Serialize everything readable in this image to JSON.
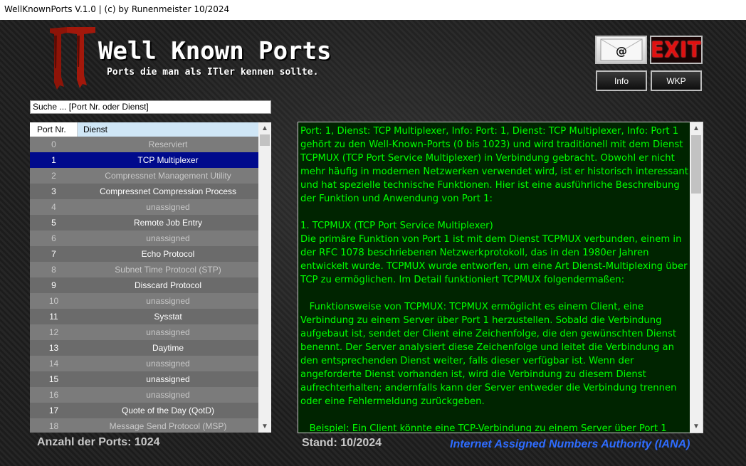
{
  "window": {
    "title": "WellKnownPorts V.1.0 | (c) by Runenmeister 10/2024"
  },
  "logo": {
    "mark": "IT",
    "title": "Well Known Ports",
    "subtitle": "Ports die man als ITler kennen sollte."
  },
  "toolbar": {
    "mail_label": "@",
    "exit_label": "EXIT",
    "info_label": "Info",
    "wkp_label": "WKP"
  },
  "search": {
    "value": "Suche ... [Port Nr. oder Dienst]"
  },
  "list": {
    "headers": {
      "port": "Port Nr.",
      "service": "Dienst"
    },
    "rows": [
      {
        "port": "0",
        "name": "Reserviert"
      },
      {
        "port": "1",
        "name": "TCP Multiplexer"
      },
      {
        "port": "2",
        "name": "Compressnet Management Utility"
      },
      {
        "port": "3",
        "name": "Compressnet Compression Process"
      },
      {
        "port": "4",
        "name": "unassigned"
      },
      {
        "port": "5",
        "name": "Remote Job Entry"
      },
      {
        "port": "6",
        "name": "unassigned"
      },
      {
        "port": "7",
        "name": "Echo Protocol"
      },
      {
        "port": "8",
        "name": "Subnet Time Protocol (STP)"
      },
      {
        "port": "9",
        "name": "Disscard Protocol"
      },
      {
        "port": "10",
        "name": "unassigned"
      },
      {
        "port": "11",
        "name": "Sysstat"
      },
      {
        "port": "12",
        "name": "unassigned"
      },
      {
        "port": "13",
        "name": "Daytime"
      },
      {
        "port": "14",
        "name": "unassigned"
      },
      {
        "port": "15",
        "name": "unassigned"
      },
      {
        "port": "16",
        "name": "unassigned"
      },
      {
        "port": "17",
        "name": "Quote of the Day (QotD)"
      },
      {
        "port": "18",
        "name": "Message Send Protocol (MSP)"
      }
    ],
    "selected_port": "1"
  },
  "info": {
    "text": "Port: 1, Dienst: TCP Multiplexer, Info: Port: 1, Dienst: TCP Multiplexer, Info: Port 1 gehört zu den Well-Known-Ports (0 bis 1023) und wird traditionell mit dem Dienst TCPMUX (TCP Port Service Multiplexer) in Verbindung gebracht. Obwohl er nicht mehr häufig in modernen Netzwerken verwendet wird, ist er historisch interessant und hat spezielle technische Funktionen. Hier ist eine ausführliche Beschreibung der Funktion und Anwendung von Port 1:\n\n1. TCPMUX (TCP Port Service Multiplexer)\nDie primäre Funktion von Port 1 ist mit dem Dienst TCPMUX verbunden, einem in der RFC 1078 beschriebenen Netzwerkprotokoll, das in den 1980er Jahren entwickelt wurde. TCPMUX wurde entworfen, um eine Art Dienst-Multiplexing über TCP zu ermöglichen. Im Detail funktioniert TCPMUX folgendermaßen:\n\n   Funktionsweise von TCPMUX: TCPMUX ermöglicht es einem Client, eine Verbindung zu einem Server über Port 1 herzustellen. Sobald die Verbindung aufgebaut ist, sendet der Client eine Zeichenfolge, die den gewünschten Dienst benennt. Der Server analysiert diese Zeichenfolge und leitet die Verbindung an den entsprechenden Dienst weiter, falls dieser verfügbar ist. Wenn der angeforderte Dienst vorhanden ist, wird die Verbindung zu diesem Dienst aufrechterhalten; andernfalls kann der Server entweder die Verbindung trennen oder eine Fehlermeldung zurückgeben.\n\n   Beispiel: Ein Client könnte eine TCP-Verbindung zu einem Server über Port 1"
  },
  "footer": {
    "count": "Anzahl der Ports: 1024",
    "stand": "Stand: 10/2024",
    "iana": "Internet Assigned Numbers Authority (IANA)"
  },
  "colors": {
    "background": "#1a1a1a",
    "info_text": "#00ff00",
    "info_bg": "#002400",
    "selected_row": "#000a8c",
    "logo_red": "#9c1a10",
    "iana_link": "#2e6cff"
  }
}
